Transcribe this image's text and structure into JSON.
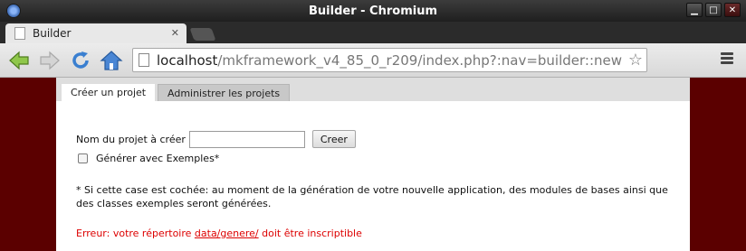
{
  "window": {
    "title": "Builder - Chromium"
  },
  "browser": {
    "tab_title": "Builder",
    "url_host": "localhost",
    "url_path": "/mkframework_v4_85_0_r209/index.php?:nav=builder::new"
  },
  "page": {
    "tabs": [
      {
        "label": "Créer un projet",
        "active": true
      },
      {
        "label": "Administrer les projets",
        "active": false
      }
    ],
    "form": {
      "name_label": "Nom du projet à créer",
      "name_value": "",
      "create_button": "Creer",
      "checkbox_label": "Générer avec Exemples*",
      "checkbox_checked": false
    },
    "note": "* Si cette case est cochée: au moment de la génération de votre nouvelle application, des modules de bases ainsi que des classes exemples seront générées.",
    "error": {
      "prefix": "Erreur: votre répertoire ",
      "link": "data/genere/",
      "suffix": " doit être inscriptible"
    }
  },
  "colors": {
    "page_background": "#5b0000",
    "error_text": "#dd0000"
  }
}
